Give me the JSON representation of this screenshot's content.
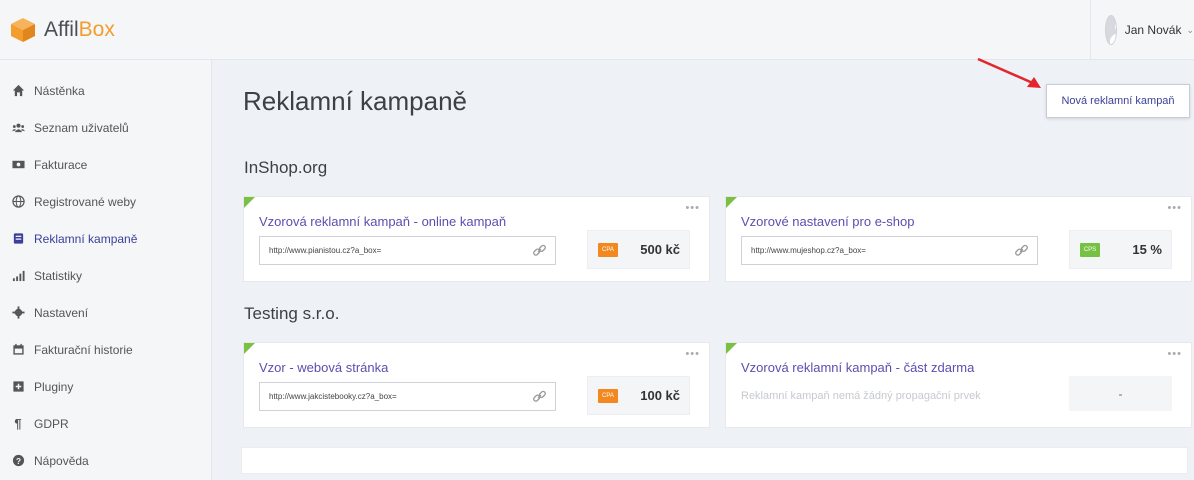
{
  "app": {
    "logo_part1": "Affil",
    "logo_part2": "Box",
    "brand_color": "#f29d2e",
    "accent_color": "#3c3f99"
  },
  "user": {
    "name": "Jan Novák"
  },
  "sidebar": {
    "items": [
      {
        "label": "Nástěnka",
        "icon": "home-icon"
      },
      {
        "label": "Seznam uživatelů",
        "icon": "users-icon"
      },
      {
        "label": "Fakturace",
        "icon": "money-icon"
      },
      {
        "label": "Registrované weby",
        "icon": "globe-icon"
      },
      {
        "label": "Reklamní kampaně",
        "icon": "campaign-icon",
        "active": true
      },
      {
        "label": "Statistiky",
        "icon": "bar-chart-icon"
      },
      {
        "label": "Nastavení",
        "icon": "gear-icon"
      },
      {
        "label": "Fakturační historie",
        "icon": "calendar-icon"
      },
      {
        "label": "Pluginy",
        "icon": "plugin-icon"
      },
      {
        "label": "GDPR",
        "icon": "pilcrow-icon"
      },
      {
        "label": "Nápověda",
        "icon": "help-icon"
      }
    ]
  },
  "main": {
    "title": "Reklamní kampaně",
    "new_button": "Nová reklamní kampaň",
    "groups": [
      {
        "name": "InShop.org",
        "campaigns": [
          {
            "title": "Vzorová reklamní kampaň - online kampaň",
            "url": "http://www.pianistou.cz?a_box=",
            "badge": "CPA",
            "badge_color": "#f2881f",
            "value": "500 kč"
          },
          {
            "title": "Vzorové nastavení pro e-shop",
            "url": "http://www.mujeshop.cz?a_box=",
            "badge": "CPS",
            "badge_color": "#76c043",
            "value": "15 %"
          }
        ]
      },
      {
        "name": "Testing s.r.o.",
        "campaigns": [
          {
            "title": "Vzor - webová stránka",
            "url": "http://www.jakcistebooky.cz?a_box=",
            "badge": "CPA",
            "badge_color": "#f2881f",
            "value": "100 kč"
          },
          {
            "title": "Vzorová reklamní kampaň - část zdarma",
            "empty_text": "Reklamní kampaň nemá žádný propagační prvek",
            "value": "-"
          }
        ]
      }
    ]
  },
  "card_menu": "•••"
}
